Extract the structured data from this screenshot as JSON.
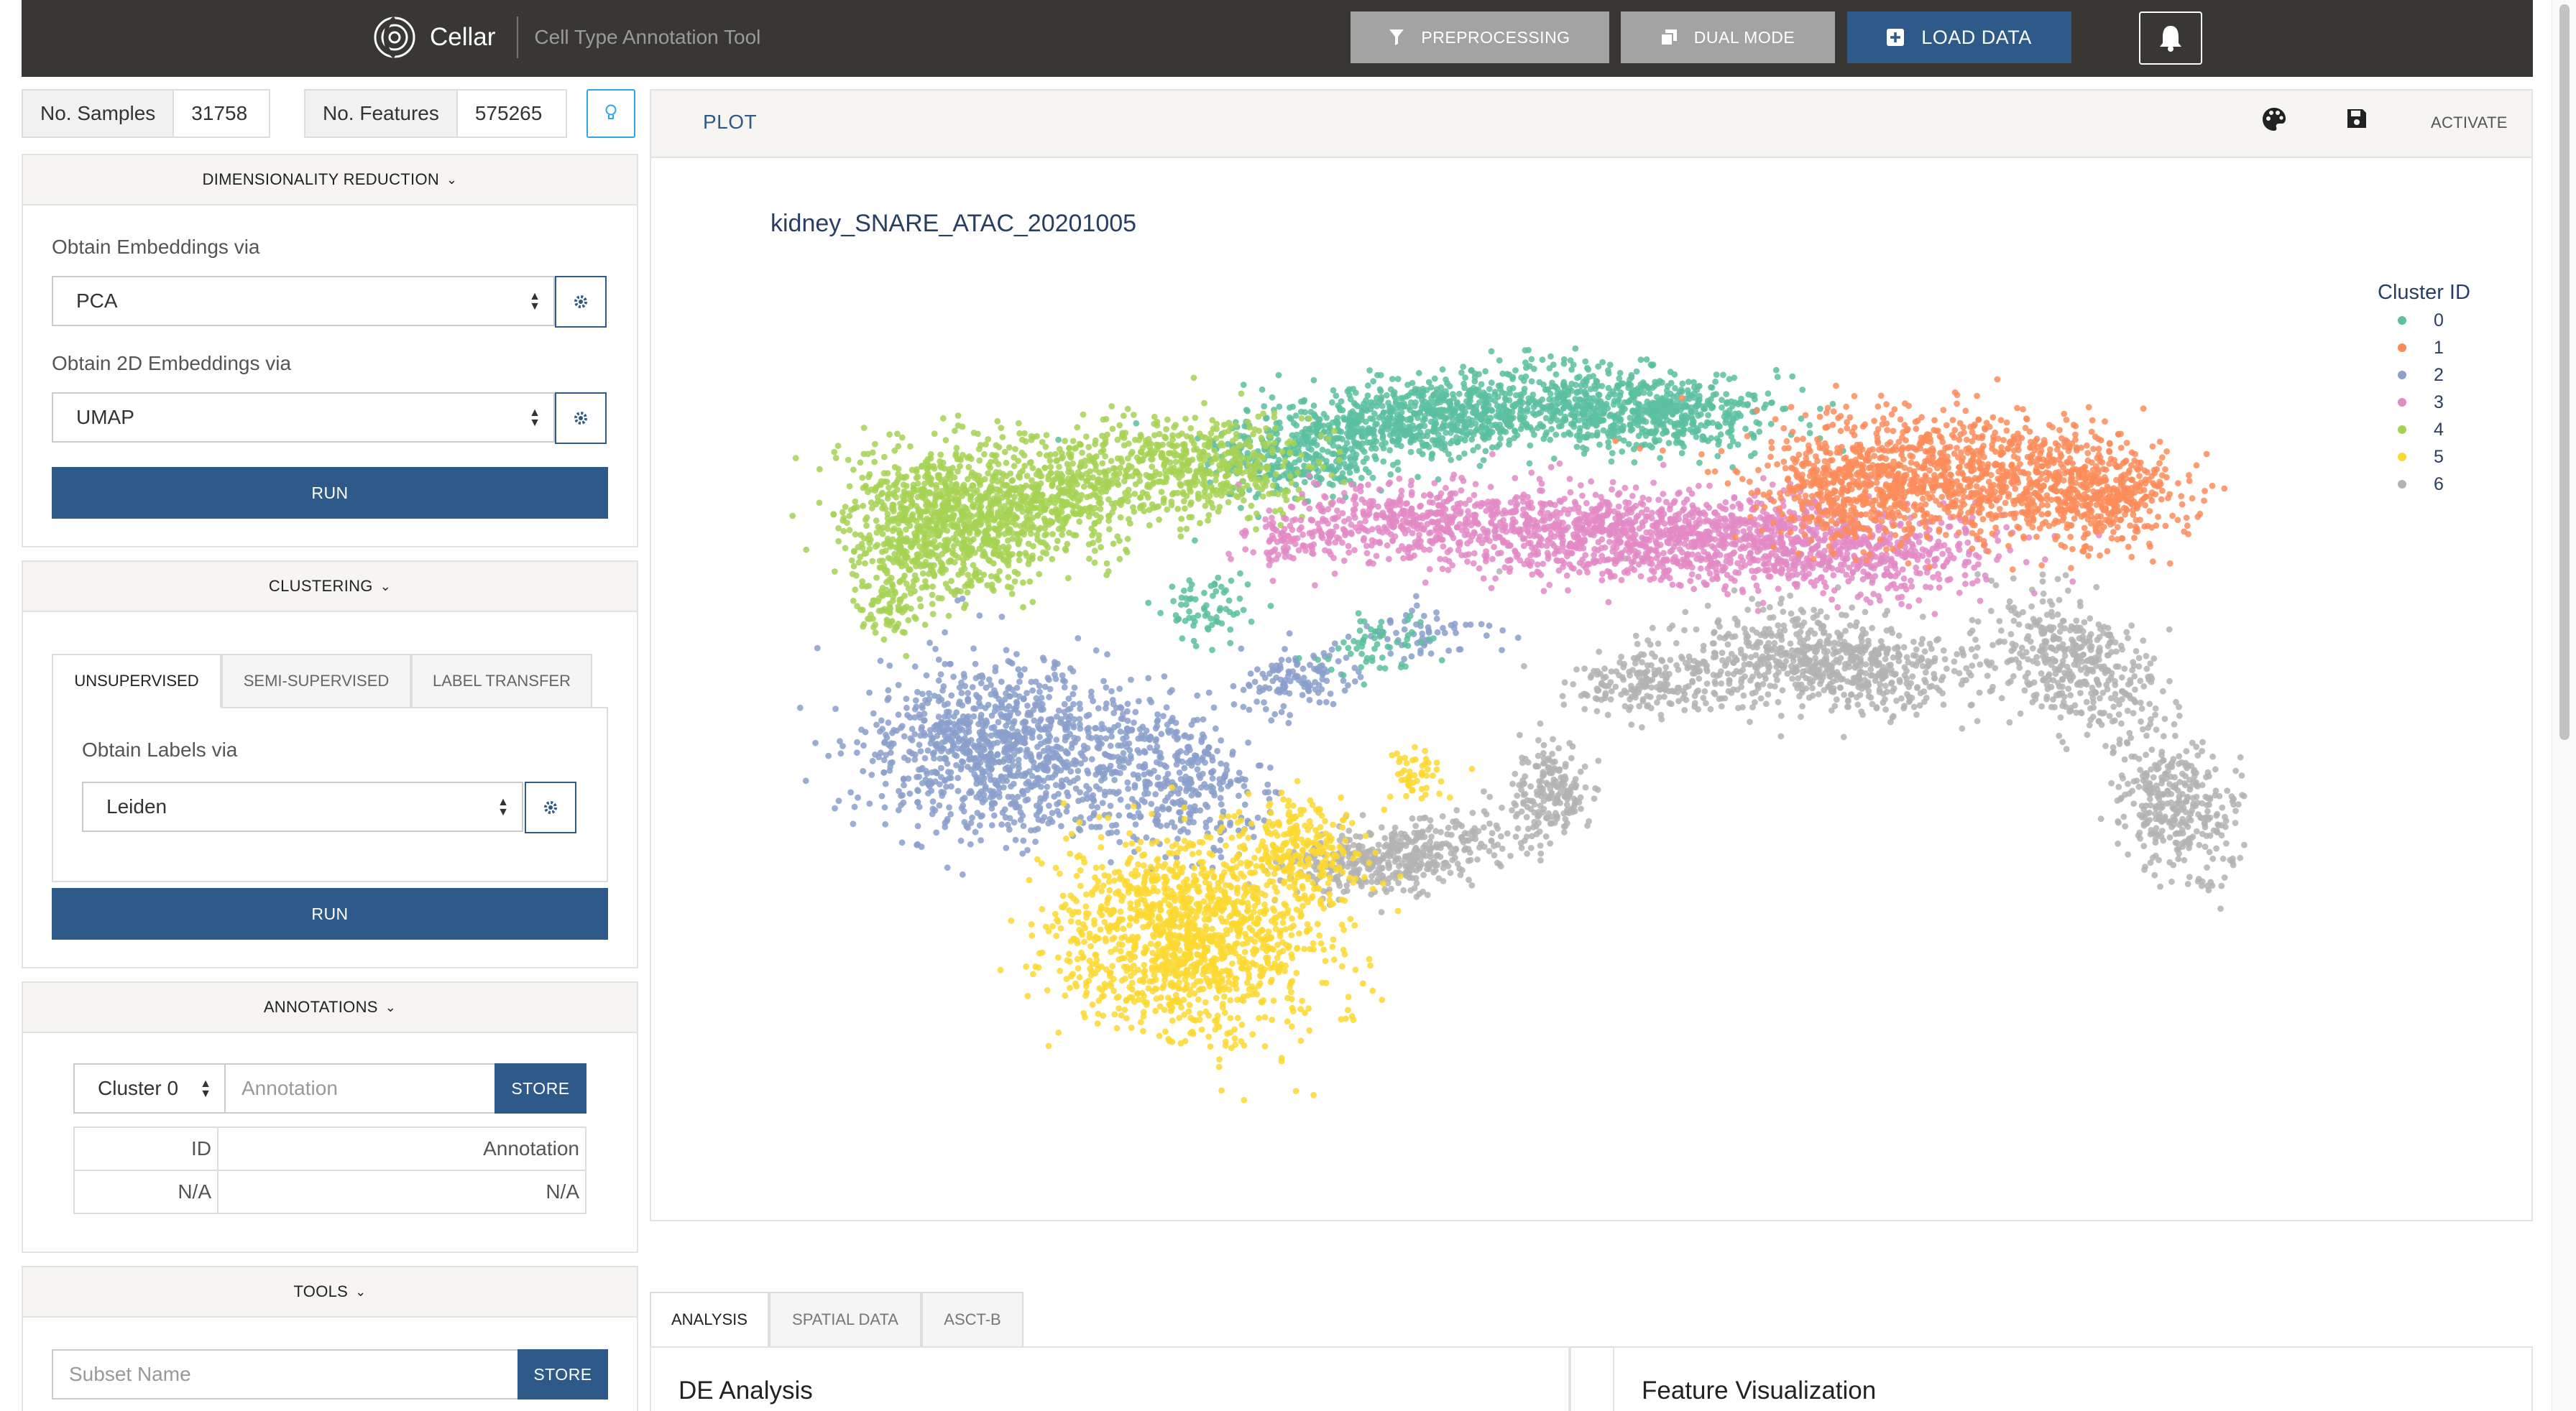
{
  "navbar": {
    "brand_name": "Cellar",
    "brand_subtitle": "Cell Type Annotation Tool",
    "preprocessing_label": "PREPROCESSING",
    "dual_mode_label": "DUAL MODE",
    "load_data_label": "LOAD DATA"
  },
  "stats": {
    "samples_label": "No. Samples",
    "samples_value": "31758",
    "features_label": "No. Features",
    "features_value": "575265"
  },
  "dim_reduction": {
    "header": "DIMENSIONALITY REDUCTION",
    "embeddings_label": "Obtain Embeddings via",
    "embeddings_value": "PCA",
    "embeddings_2d_label": "Obtain 2D Embeddings via",
    "embeddings_2d_value": "UMAP",
    "run_label": "RUN"
  },
  "clustering": {
    "header": "CLUSTERING",
    "tabs": [
      "UNSUPERVISED",
      "SEMI-SUPERVISED",
      "LABEL TRANSFER"
    ],
    "labels_label": "Obtain Labels via",
    "labels_value": "Leiden",
    "run_label": "RUN"
  },
  "annotations": {
    "header": "ANNOTATIONS",
    "cluster_value": "Cluster 0",
    "annotation_placeholder": "Annotation",
    "store_label": "STORE",
    "table_headers": [
      "ID",
      "Annotation"
    ],
    "table_rows": [
      [
        "N/A",
        "N/A"
      ]
    ]
  },
  "tools": {
    "header": "TOOLS",
    "subset_placeholder": "Subset Name",
    "store_label": "STORE"
  },
  "plot": {
    "tab_label": "PLOT",
    "activate_label": "ACTIVATE"
  },
  "bottom": {
    "tabs": [
      "ANALYSIS",
      "SPATIAL DATA",
      "ASCT-B"
    ],
    "de_title": "DE Analysis",
    "feature_title": "Feature Visualization"
  },
  "chart_data": {
    "type": "scatter",
    "title": "kidney_SNARE_ATAC_20201005",
    "legend_title": "Cluster ID",
    "legend_position": "top-right",
    "xlabel": "",
    "ylabel": "",
    "series": [
      {
        "name": "0",
        "color": "#5bbfa0"
      },
      {
        "name": "1",
        "color": "#fb8c5a"
      },
      {
        "name": "2",
        "color": "#8b9fcb"
      },
      {
        "name": "3",
        "color": "#e389c6"
      },
      {
        "name": "4",
        "color": "#a6d253"
      },
      {
        "name": "5",
        "color": "#fcd830"
      },
      {
        "name": "6",
        "color": "#b3b3b3"
      }
    ]
  }
}
